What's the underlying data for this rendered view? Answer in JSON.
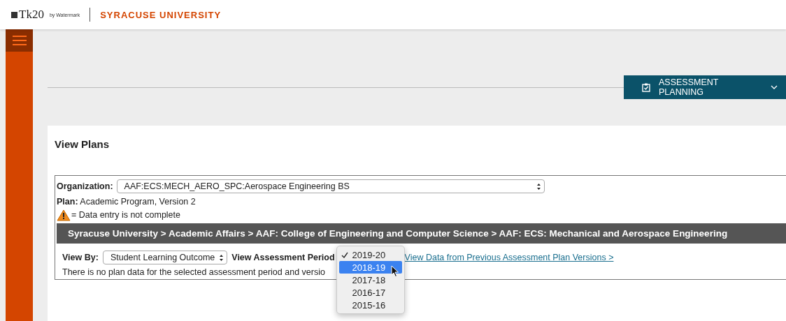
{
  "header": {
    "logo": "Tk20",
    "logo_by": "by Watermark",
    "university": "SYRACUSE UNIVERSITY"
  },
  "nav_button": {
    "label": "ASSESSMENT PLANNING"
  },
  "page": {
    "title": "View Plans",
    "organization": {
      "label": "Organization:",
      "value": "AAF:ECS:MECH_AERO_SPC:Aerospace Engineering BS"
    },
    "plan": {
      "label": "Plan:",
      "value": "Academic Program,  Version 2"
    },
    "legend": "= Data entry is not complete",
    "breadcrumb": "Syracuse University > Academic Affairs > AAF: College of Engineering and Computer Science > AAF: ECS: Mechanical and Aerospace Engineering",
    "view_by": {
      "label": "View By:",
      "value": "Student Learning Outcome"
    },
    "period": {
      "label": "View Assessment Period",
      "options": [
        {
          "label": "2019-20",
          "checked": true,
          "selected": false
        },
        {
          "label": "2018-19",
          "checked": false,
          "selected": true
        },
        {
          "label": "2017-18",
          "checked": false,
          "selected": false
        },
        {
          "label": "2016-17",
          "checked": false,
          "selected": false
        },
        {
          "label": "2015-16",
          "checked": false,
          "selected": false
        }
      ]
    },
    "previous_link": "View Data from Previous Assessment Plan Versions >",
    "message": "There is no plan data for the selected assessment period and versio"
  }
}
